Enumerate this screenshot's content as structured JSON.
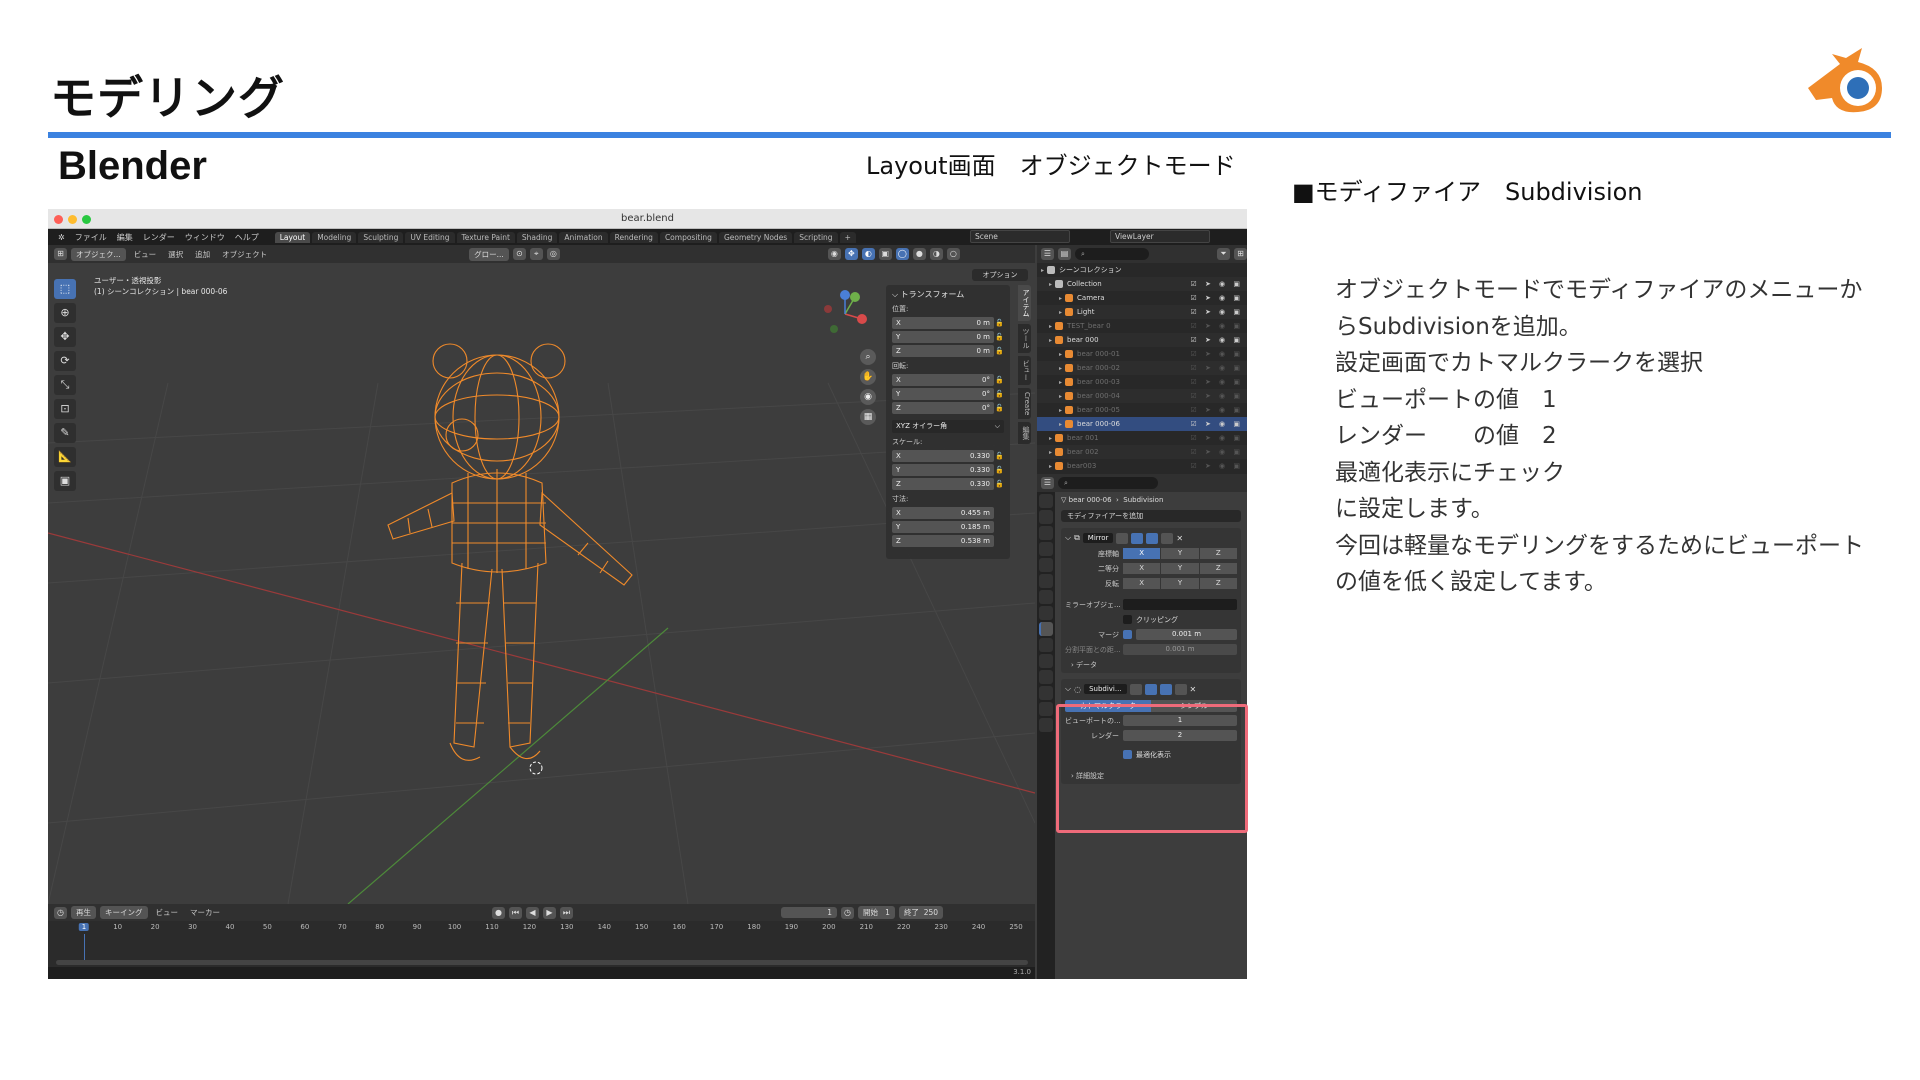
{
  "slide": {
    "title": "モデリング",
    "subtitle": "Blender",
    "mode_caption": "Layout画面　オブジェクトモード",
    "modifier_heading": "■モディファイア　Subdivision",
    "description": [
      "オブジェクトモードでモディファイアのメニューか",
      "らSubdivisionを追加。",
      "設定画面でカトマルクラークを選択",
      "ビューポートの値　1",
      "レンダー　　の値　2",
      "最適化表示にチェック",
      "に設定します。",
      "今回は軽量なモデリングをするためにビューポート",
      "の値を低く設定してます。"
    ],
    "accent_color": "#3b82e0",
    "highlight_color": "#ef6b7a"
  },
  "window": {
    "title": "bear.blend",
    "menu": [
      "ファイル",
      "編集",
      "レンダー",
      "ウィンドウ",
      "ヘルプ"
    ],
    "workspaces": [
      "Layout",
      "Modeling",
      "Sculpting",
      "UV Editing",
      "Texture Paint",
      "Shading",
      "Animation",
      "Rendering",
      "Compositing",
      "Geometry Nodes",
      "Scripting"
    ],
    "active_workspace": "Layout",
    "scene": "Scene",
    "view_layer": "ViewLayer",
    "version": "3.1.0"
  },
  "viewport": {
    "mode": "オブジェク...",
    "menus": [
      "ビュー",
      "選択",
      "追加",
      "オブジェクト"
    ],
    "transform_orientation": "グロー...",
    "view_name": "ユーザー・透視投影",
    "collection_info": "(1) シーンコレクション | bear 000-06",
    "options_label": "オプション",
    "side_tabs": [
      "アイテム",
      "ツール",
      "ビュー",
      "Create",
      "編集"
    ],
    "n_panel": {
      "header": "トランスフォーム",
      "location_label": "位置:",
      "location": [
        [
          "X",
          "0 m"
        ],
        [
          "Y",
          "0 m"
        ],
        [
          "Z",
          "0 m"
        ]
      ],
      "rotation_label": "回転:",
      "rotation": [
        [
          "X",
          "0°"
        ],
        [
          "Y",
          "0°"
        ],
        [
          "Z",
          "0°"
        ]
      ],
      "rotation_mode": "XYZ オイラー角",
      "scale_label": "スケール:",
      "scale": [
        [
          "X",
          "0.330"
        ],
        [
          "Y",
          "0.330"
        ],
        [
          "Z",
          "0.330"
        ]
      ],
      "dimensions_label": "寸法:",
      "dimensions": [
        [
          "X",
          "0.455 m"
        ],
        [
          "Y",
          "0.185 m"
        ],
        [
          "Z",
          "0.538 m"
        ]
      ]
    },
    "model_color": "#f08a2a"
  },
  "timeline": {
    "menus": [
      "再生",
      "キーイング",
      "ビュー",
      "マーカー"
    ],
    "current_frame": "1",
    "start_label": "開始",
    "start": "1",
    "end_label": "終了",
    "end": "250",
    "ticks": [
      "1",
      "10",
      "20",
      "30",
      "40",
      "50",
      "60",
      "70",
      "80",
      "90",
      "100",
      "110",
      "120",
      "130",
      "140",
      "150",
      "160",
      "170",
      "180",
      "190",
      "200",
      "210",
      "220",
      "230",
      "240",
      "250"
    ]
  },
  "outliner": {
    "rows": [
      {
        "label": "シーンコレクション",
        "state": "normal"
      },
      {
        "label": "Collection",
        "state": "normal"
      },
      {
        "label": "Camera",
        "state": "normal"
      },
      {
        "label": "Light",
        "state": "normal"
      },
      {
        "label": "TEST_bear 0",
        "state": "dim"
      },
      {
        "label": "bear 000",
        "state": "normal"
      },
      {
        "label": "bear 000-01",
        "state": "dim"
      },
      {
        "label": "bear 000-02",
        "state": "dim"
      },
      {
        "label": "bear 000-03",
        "state": "dim"
      },
      {
        "label": "bear 000-04",
        "state": "dim"
      },
      {
        "label": "bear 000-05",
        "state": "dim"
      },
      {
        "label": "bear 000-06",
        "state": "selected"
      },
      {
        "label": "bear 001",
        "state": "dim"
      },
      {
        "label": "bear 002",
        "state": "dim"
      },
      {
        "label": "bear003",
        "state": "dim"
      }
    ]
  },
  "properties": {
    "breadcrumb_object": "bear 000-06",
    "breadcrumb_section": "Subdivision",
    "add_modifier": "モディファイアーを追加",
    "mirror": {
      "name": "Mirror",
      "axis_label": "座標軸",
      "bisect_label": "二等分",
      "flip_label": "反転",
      "axes": [
        "X",
        "Y",
        "Z"
      ],
      "mirror_object_label": "ミラーオブジェ...",
      "clipping_label": "クリッピング",
      "merge_label": "マージ",
      "merge_value": "0.001 m",
      "bisect_distance_label": "分割平面との距...",
      "bisect_distance_value": "0.001 m",
      "data_label": "データ"
    },
    "subdivision": {
      "name": "Subdivi...",
      "catmull_clark": "カトマルクラーク",
      "simple": "シンプル",
      "viewport_label": "ビューポートの...",
      "viewport_value": "1",
      "render_label": "レンダー",
      "render_value": "2",
      "optimal_display": "最適化表示",
      "advanced_label": "詳細設定"
    }
  }
}
